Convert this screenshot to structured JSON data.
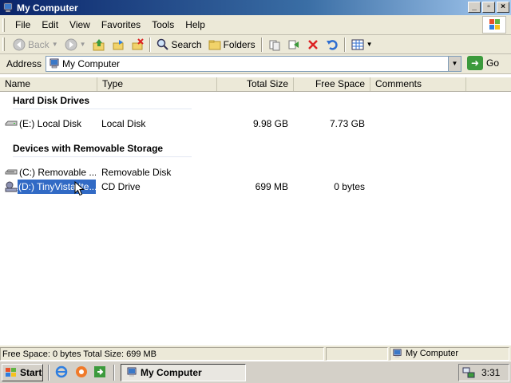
{
  "window": {
    "title": "My Computer",
    "buttons": {
      "minimize": "_",
      "maximize": "▫",
      "close": "×"
    }
  },
  "menubar": {
    "items": [
      "File",
      "Edit",
      "View",
      "Favorites",
      "Tools",
      "Help"
    ]
  },
  "toolbar": {
    "back": "Back",
    "search": "Search",
    "folders": "Folders"
  },
  "address": {
    "label": "Address",
    "value": "My Computer",
    "go": "Go"
  },
  "columns": [
    "Name",
    "Type",
    "Total Size",
    "Free Space",
    "Comments"
  ],
  "groups": [
    {
      "title": "Hard Disk Drives",
      "rows": [
        {
          "name": "(E:) Local Disk",
          "type": "Local Disk",
          "total": "9.98 GB",
          "free": "7.73 GB",
          "icon": "hard-drive-icon",
          "selected": false
        }
      ]
    },
    {
      "title": "Devices with Removable Storage",
      "rows": [
        {
          "name": "(C:) Removable ...",
          "type": "Removable Disk",
          "total": "",
          "free": "",
          "icon": "removable-drive-icon",
          "selected": false
        },
        {
          "name": "(D:) TinyVista Ite...",
          "type": "CD Drive",
          "total": "699 MB",
          "free": "0 bytes",
          "icon": "cd-drive-icon",
          "selected": true
        }
      ]
    }
  ],
  "statusbar": {
    "info": "Free Space: 0 bytes Total Size: 699 MB",
    "zone": "My Computer"
  },
  "taskbar": {
    "start": "Start",
    "task": "My Computer",
    "clock": "3:31"
  }
}
